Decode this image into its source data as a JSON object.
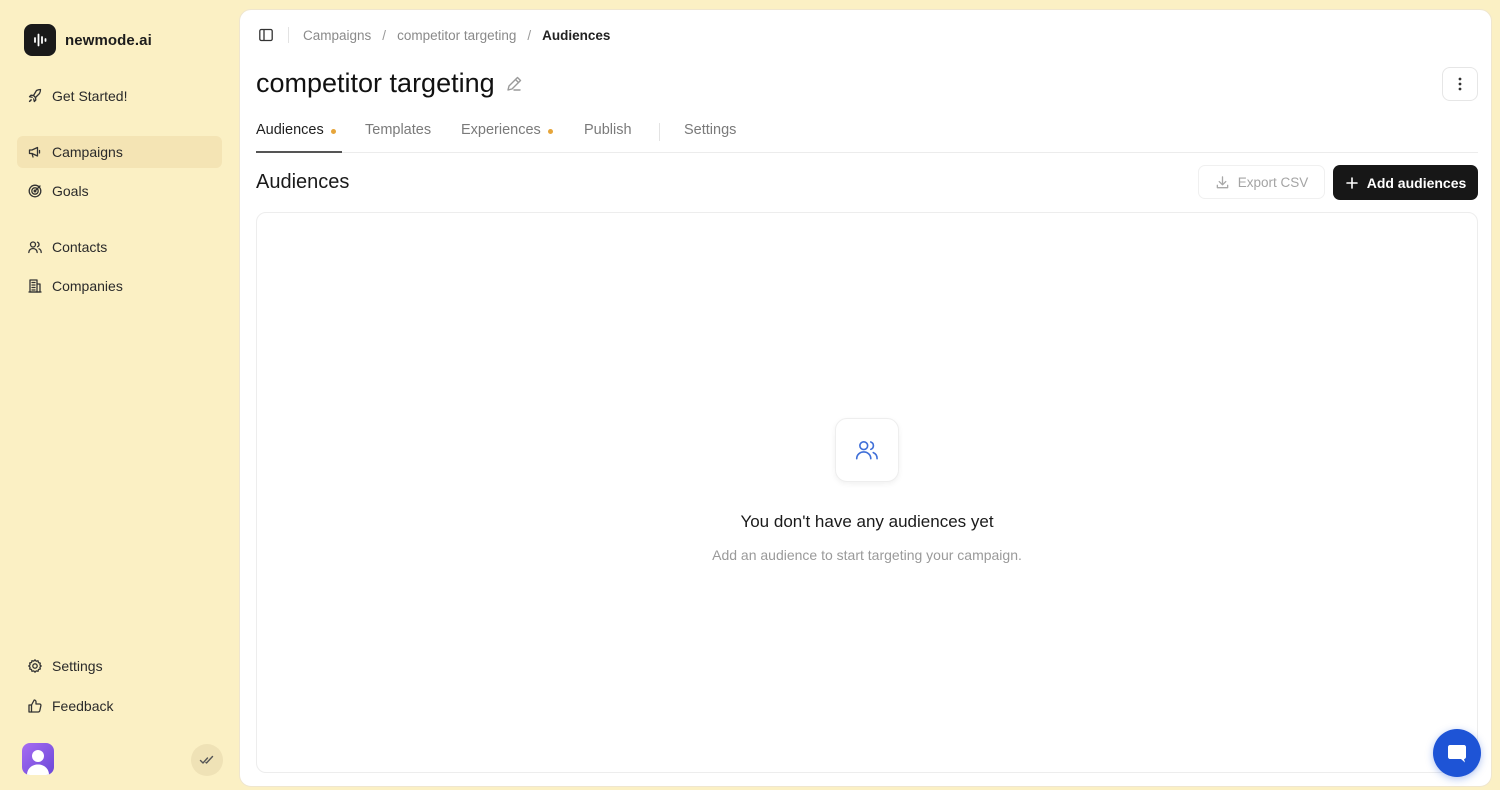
{
  "brand": {
    "name": "newmode.ai"
  },
  "sidebar": {
    "get_started": "Get Started!",
    "items": [
      {
        "label": "Campaigns",
        "icon": "megaphone-icon"
      },
      {
        "label": "Goals",
        "icon": "target-icon"
      },
      {
        "label": "Contacts",
        "icon": "users-icon"
      },
      {
        "label": "Companies",
        "icon": "building-icon"
      }
    ],
    "bottom": [
      {
        "label": "Settings",
        "icon": "gear-icon"
      },
      {
        "label": "Feedback",
        "icon": "thumbs-up-icon"
      }
    ]
  },
  "breadcrumb": {
    "items": [
      "Campaigns",
      "competitor targeting",
      "Audiences"
    ],
    "separator": "/"
  },
  "page": {
    "title": "competitor targeting"
  },
  "tabs": [
    {
      "label": "Audiences",
      "dot": true,
      "active": true
    },
    {
      "label": "Templates",
      "dot": false
    },
    {
      "label": "Experiences",
      "dot": true
    },
    {
      "label": "Publish",
      "dot": false
    },
    {
      "label": "Settings",
      "dot": false
    }
  ],
  "section": {
    "title": "Audiences",
    "export_label": "Export CSV",
    "add_label": "Add audiences"
  },
  "empty_state": {
    "title": "You don't have any audiences yet",
    "subtitle": "Add an audience to start targeting your campaign."
  },
  "colors": {
    "sidebar_bg": "#fbf0c4",
    "active_item_bg": "#f4e4b4",
    "primary_button": "#171717",
    "tab_dot": "#e6a53a",
    "chat_button": "#1e54d6",
    "empty_icon": "#3f6fd8"
  }
}
